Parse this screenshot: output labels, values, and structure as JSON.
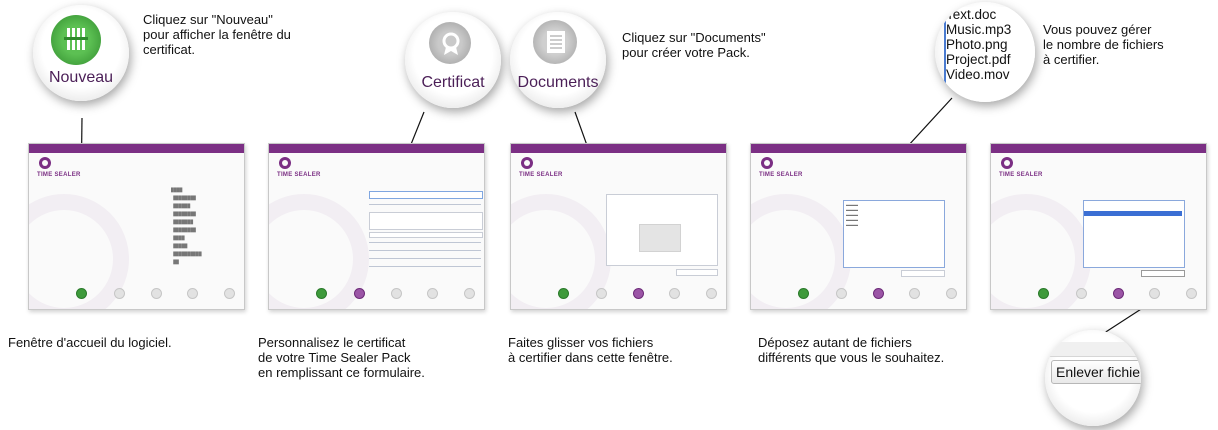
{
  "callouts": {
    "nouveau": "Cliquez sur \"Nouveau\"\npour afficher la fenêtre du\ncertificat.",
    "documents": "Cliquez sur \"Documents\"\npour créer votre Pack.",
    "gerer": "Vous pouvez gérer\nle nombre de fichiers\nà certifier."
  },
  "magnifiers": {
    "nouveau": "Nouveau",
    "certificat": "Certificat",
    "documents": "Documents",
    "enlever": "Enlever fichier"
  },
  "files": [
    "Text.doc",
    "Music.mp3",
    "Photo.png",
    "Project.pdf",
    "Video.mov"
  ],
  "captions": {
    "c1": "Fenêtre d'accueil du logiciel.",
    "c2": "Personnalisez le certificat\nde votre Time Sealer Pack\nen remplissant ce formulaire.",
    "c3": "Faites glisser vos fichiers\nà certifier dans cette fenêtre.",
    "c4": "Déposez autant de fichiers\ndifférents que vous le souhaitez."
  },
  "thumb_brand": "TIME SEALER",
  "colors": {
    "accent": "#7b2f84",
    "green": "#3e9a3b"
  }
}
